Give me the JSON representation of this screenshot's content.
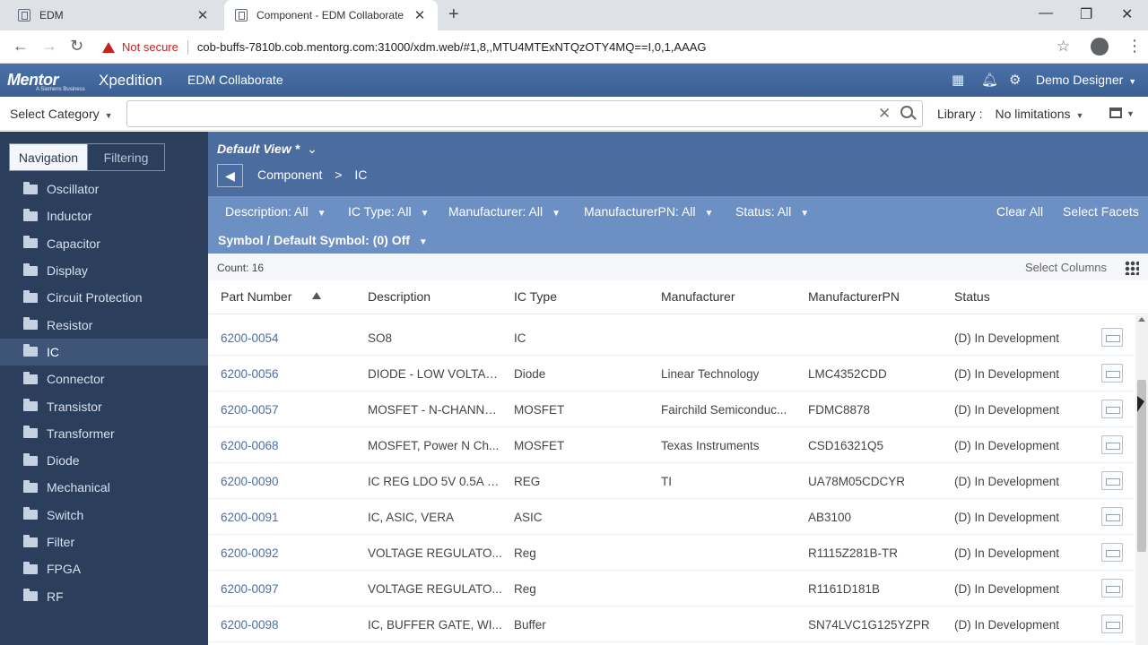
{
  "browser": {
    "tabs": [
      {
        "title": "EDM"
      },
      {
        "title": "Component - EDM Collaborate"
      }
    ],
    "not_secure": "Not secure",
    "url": "cob-buffs-7810b.cob.mentorg.com:31000/xdm.web/#1,8,,MTU4MTExNTQzOTY4MQ==I,0,1,AAAG"
  },
  "header": {
    "logo": "Mentor",
    "logo_sub": "A Siemens Business",
    "product": "Xpedition",
    "app": "EDM Collaborate",
    "user": "Demo Designer"
  },
  "search": {
    "category": "Select Category",
    "placeholder": "",
    "library_label": "Library :",
    "library_value": "No limitations"
  },
  "sidebar": {
    "tabs": [
      "Navigation",
      "Filtering"
    ],
    "items": [
      {
        "label": "Oscillator"
      },
      {
        "label": "Inductor"
      },
      {
        "label": "Capacitor"
      },
      {
        "label": "Display"
      },
      {
        "label": "Circuit Protection"
      },
      {
        "label": "Resistor"
      },
      {
        "label": "IC",
        "selected": true
      },
      {
        "label": "Connector"
      },
      {
        "label": "Transistor"
      },
      {
        "label": "Transformer"
      },
      {
        "label": "Diode"
      },
      {
        "label": "Mechanical"
      },
      {
        "label": "Switch"
      },
      {
        "label": "Filter"
      },
      {
        "label": "FPGA"
      },
      {
        "label": "RF"
      }
    ]
  },
  "view": {
    "name": "Default View *",
    "breadcrumb": [
      "Component",
      ">",
      "IC"
    ]
  },
  "facets": {
    "items": [
      "Description: All",
      "IC Type: All",
      "Manufacturer: All",
      "ManufacturerPN: All",
      "Status: All"
    ],
    "clear_all": "Clear All",
    "select_facets": "Select Facets",
    "symbol": "Symbol / Default Symbol: (0) Off"
  },
  "table": {
    "count": "Count: 16",
    "select_columns": "Select Columns",
    "columns": [
      "Part Number",
      "Description",
      "IC Type",
      "Manufacturer",
      "ManufacturerPN",
      "Status"
    ],
    "rows": [
      {
        "pn": "6200-0054",
        "desc": "SO8",
        "type": "IC",
        "mfr": "",
        "mpn": "",
        "status": "(D) In Development"
      },
      {
        "pn": "6200-0056",
        "desc": "DIODE - LOW VOLTAG...",
        "type": "Diode",
        "mfr": "Linear Technology",
        "mpn": "LMC4352CDD",
        "status": "(D) In Development"
      },
      {
        "pn": "6200-0057",
        "desc": "MOSFET - N-CHANNE...",
        "type": "MOSFET",
        "mfr": "Fairchild Semiconduc...",
        "mpn": "FDMC8878",
        "status": "(D) In Development"
      },
      {
        "pn": "6200-0068",
        "desc": "MOSFET, Power N Ch...",
        "type": "MOSFET",
        "mfr": "Texas Instruments",
        "mpn": "CSD16321Q5",
        "status": "(D) In Development"
      },
      {
        "pn": "6200-0090",
        "desc": "IC REG LDO 5V 0.5A S...",
        "type": "REG",
        "mfr": "TI",
        "mpn": "UA78M05CDCYR",
        "status": "(D) In Development"
      },
      {
        "pn": "6200-0091",
        "desc": "IC, ASIC, VERA",
        "type": "ASIC",
        "mfr": "",
        "mpn": "AB3100",
        "status": "(D) In Development"
      },
      {
        "pn": "6200-0092",
        "desc": "VOLTAGE REGULATO...",
        "type": "Reg",
        "mfr": "",
        "mpn": "R1115Z281B-TR",
        "status": "(D) In Development"
      },
      {
        "pn": "6200-0097",
        "desc": "VOLTAGE REGULATO...",
        "type": "Reg",
        "mfr": "",
        "mpn": "R1161D181B",
        "status": "(D) In Development"
      },
      {
        "pn": "6200-0098",
        "desc": "IC, BUFFER GATE, WI...",
        "type": "Buffer",
        "mfr": "",
        "mpn": "SN74LVC1G125YZPR",
        "status": "(D) In Development"
      }
    ]
  }
}
